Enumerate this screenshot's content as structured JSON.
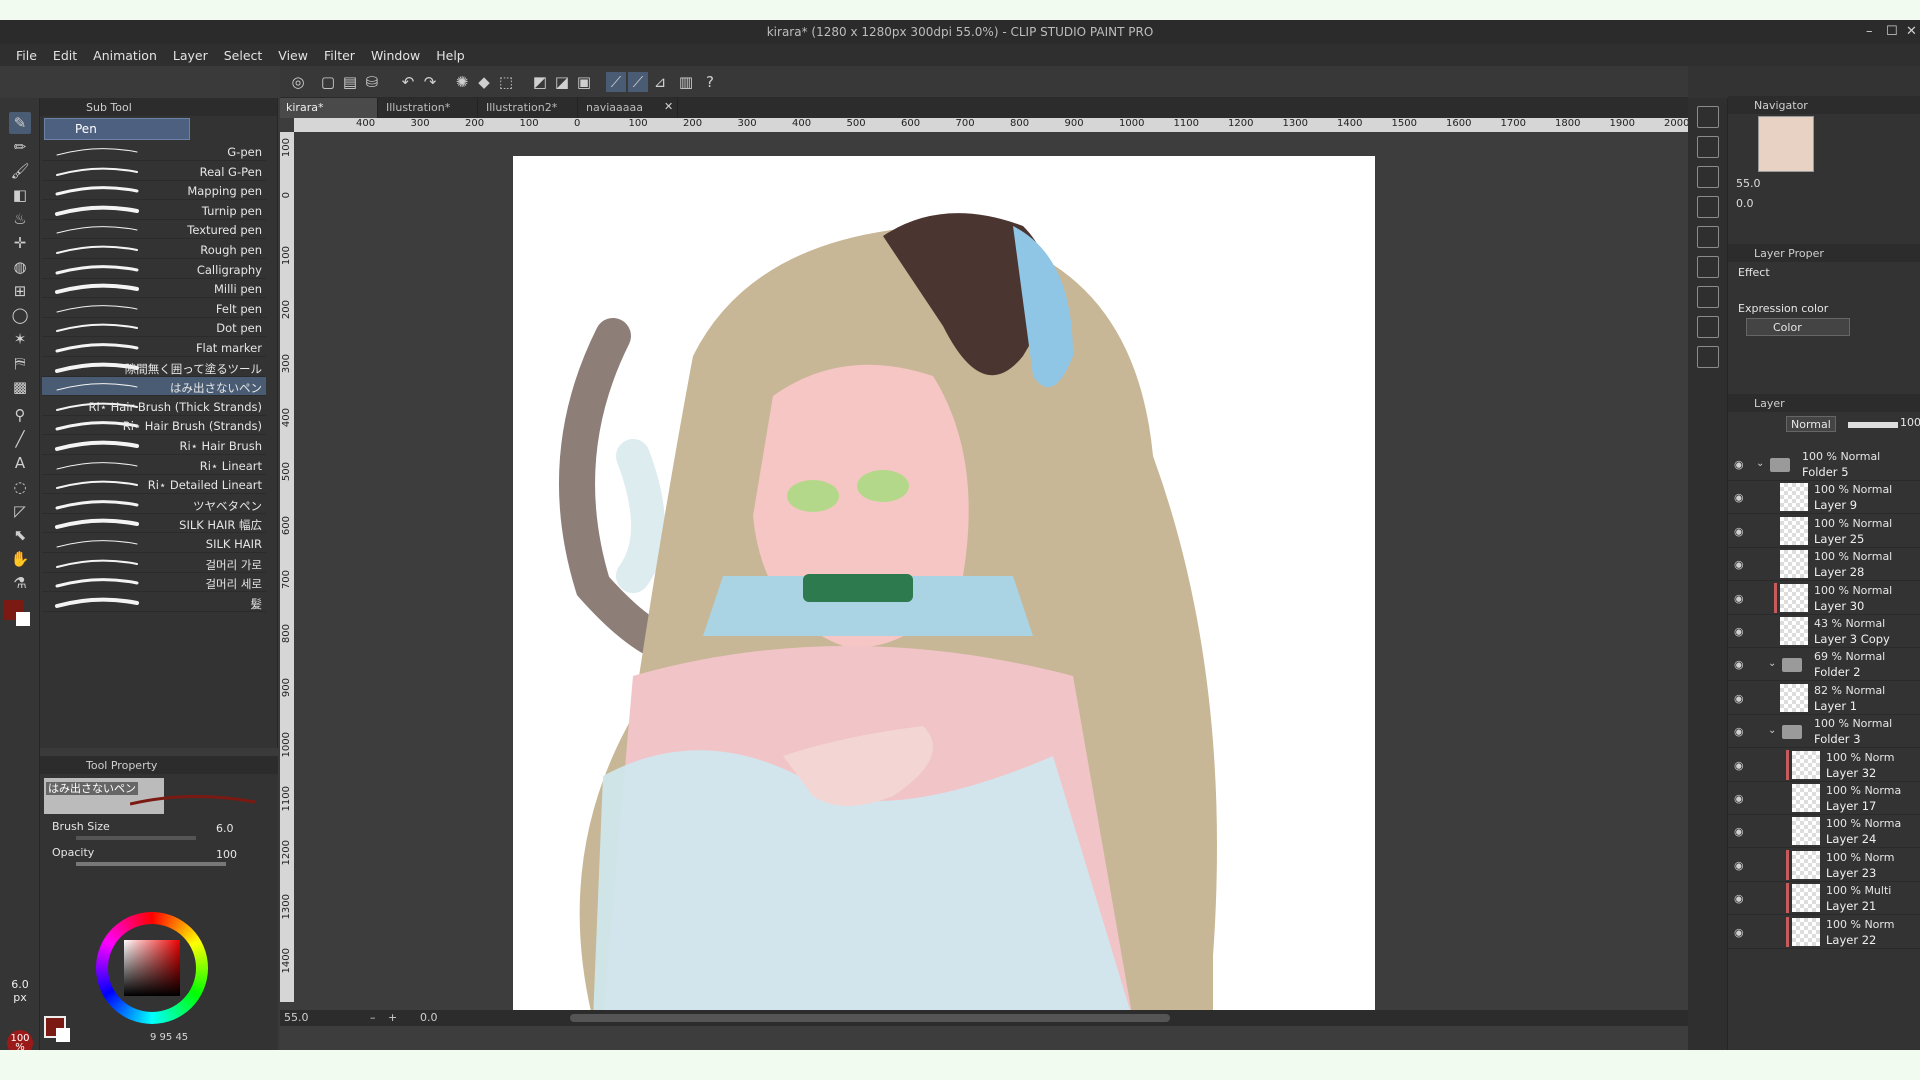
{
  "window": {
    "title": "kirara* (1280 x 1280px 300dpi 55.0%) - CLIP STUDIO PAINT PRO"
  },
  "menu": [
    "File",
    "Edit",
    "Animation",
    "Layer",
    "Select",
    "View",
    "Filter",
    "Window",
    "Help"
  ],
  "subtool": {
    "panel_title": "Sub Tool",
    "active_group": "Pen",
    "brushes": [
      "G-pen",
      "Real G-Pen",
      "Mapping pen",
      "Turnip pen",
      "Textured pen",
      "Rough pen",
      "Calligraphy",
      "Milli pen",
      "Felt pen",
      "Dot pen",
      "Flat marker",
      "隙間無く囲って塗るツール",
      "はみ出さないペン",
      "Ri⋆ Hair Brush (Thick Strands)",
      "Ri⋆ Hair Brush (Strands)",
      "Ri⋆ Hair Brush",
      "Ri⋆ Lineart",
      "Ri⋆ Detailed Lineart",
      "ツヤベタペン",
      "SILK HAIR 幅広",
      "SILK HAIR",
      "걸머리 가로",
      "걸머리 세로",
      "髪"
    ],
    "selected_index": 12
  },
  "tool_property": {
    "panel_title": "Tool Property",
    "tool_name": "はみ出さないペン",
    "brush_size_label": "Brush Size",
    "brush_size_value": "6.0",
    "opacity_label": "Opacity",
    "opacity_value": "100"
  },
  "left_indicators": {
    "size": "6.0",
    "size_unit": "px",
    "opacity": "100",
    "opacity_unit": "%"
  },
  "color": {
    "main": "#7a1a12",
    "sub": "#ffffff",
    "readout": "9 95 45"
  },
  "doc_tabs": [
    {
      "label": "kirara*",
      "active": true
    },
    {
      "label": "Illustration*",
      "active": false
    },
    {
      "label": "Illustration2*",
      "active": false
    },
    {
      "label": "naviaaaaa",
      "active": false
    }
  ],
  "ruler_h": [
    "400",
    "300",
    "200",
    "100",
    "0",
    "100",
    "200",
    "300",
    "400",
    "500",
    "600",
    "700",
    "800",
    "900",
    "1000",
    "1100",
    "1200",
    "1300",
    "1400",
    "1500",
    "1600",
    "1700",
    "1800",
    "1900",
    "2000"
  ],
  "ruler_v": [
    "100",
    "0",
    "100",
    "200",
    "300",
    "400",
    "500",
    "600",
    "700",
    "800",
    "900",
    "1000",
    "1100",
    "1200",
    "1300",
    "1400"
  ],
  "status": {
    "zoom": "55.0",
    "angle": "0.0"
  },
  "navigator": {
    "title": "Navigator",
    "zoom": "55.0",
    "angle": "0.0"
  },
  "layer_property": {
    "title": "Layer Proper",
    "effect_label": "Effect",
    "expression_color_label": "Expression color",
    "expression_color_value": "Color"
  },
  "layer_panel": {
    "title": "Layer",
    "blend_mode": "Normal",
    "opacity": "100",
    "layers": [
      {
        "mode": "100 % Normal",
        "name": "Folder 5",
        "type": "folder",
        "indent": 0,
        "mask": false
      },
      {
        "mode": "100 % Normal",
        "name": "Layer 9",
        "type": "layer",
        "indent": 1,
        "mask": false
      },
      {
        "mode": "100 % Normal",
        "name": "Layer 25",
        "type": "layer",
        "indent": 1,
        "mask": false
      },
      {
        "mode": "100 % Normal",
        "name": "Layer 28",
        "type": "layer",
        "indent": 1,
        "mask": false
      },
      {
        "mode": "100 % Normal",
        "name": "Layer 30",
        "type": "layer",
        "indent": 1,
        "mask": true
      },
      {
        "mode": "43 % Normal",
        "name": "Layer 3 Copy",
        "type": "layer",
        "indent": 1,
        "mask": false
      },
      {
        "mode": "69 % Normal",
        "name": "Folder 2",
        "type": "folder",
        "indent": 1,
        "mask": false
      },
      {
        "mode": "82 % Normal",
        "name": "Layer 1",
        "type": "layer",
        "indent": 1,
        "mask": false
      },
      {
        "mode": "100 % Normal",
        "name": "Folder 3",
        "type": "folder",
        "indent": 1,
        "mask": false
      },
      {
        "mode": "100 % Norm",
        "name": "Layer 32",
        "type": "layer",
        "indent": 2,
        "mask": true
      },
      {
        "mode": "100 % Norma",
        "name": "Layer 17",
        "type": "layer",
        "indent": 2,
        "mask": false
      },
      {
        "mode": "100 % Norma",
        "name": "Layer 24",
        "type": "layer",
        "indent": 2,
        "mask": false
      },
      {
        "mode": "100 % Norm",
        "name": "Layer 23",
        "type": "layer",
        "indent": 2,
        "mask": true
      },
      {
        "mode": "100 % Multi",
        "name": "Layer 21",
        "type": "layer",
        "indent": 2,
        "mask": true
      },
      {
        "mode": "100 % Norm",
        "name": "Layer 22",
        "type": "layer",
        "indent": 2,
        "mask": true
      }
    ]
  }
}
